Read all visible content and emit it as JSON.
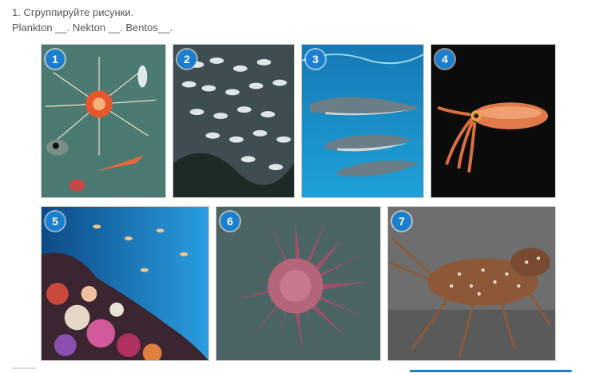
{
  "task": {
    "title": "1. Сгруппируйте рисунки.",
    "subtitle": "Plankton __. Nekton __. Bentos__."
  },
  "photos": [
    {
      "number": "1",
      "subject": "plankton"
    },
    {
      "number": "2",
      "subject": "fish-school"
    },
    {
      "number": "3",
      "subject": "dolphins"
    },
    {
      "number": "4",
      "subject": "squid"
    },
    {
      "number": "5",
      "subject": "coral-reef"
    },
    {
      "number": "6",
      "subject": "starfish"
    },
    {
      "number": "7",
      "subject": "lobster"
    }
  ],
  "colors": {
    "badge": "#1a7fd1"
  }
}
